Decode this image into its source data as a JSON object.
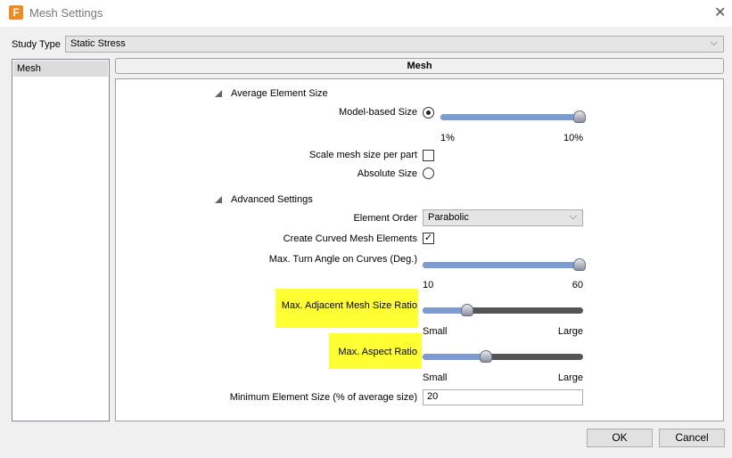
{
  "window": {
    "title": "Mesh Settings",
    "logo": "F"
  },
  "study_type": {
    "label": "Study Type",
    "value": "Static Stress"
  },
  "sidebar": {
    "items": [
      {
        "label": "Mesh"
      }
    ]
  },
  "panel": {
    "title": "Mesh"
  },
  "average_element_size": {
    "heading": "Average Element Size",
    "model_based_label": "Model-based Size",
    "model_based_selected": true,
    "slider_value_percent": 100,
    "min_label": "1%",
    "max_label": "10%",
    "scale_per_part_label": "Scale mesh size per part",
    "scale_per_part_checked": false,
    "absolute_label": "Absolute Size",
    "absolute_selected": false
  },
  "advanced": {
    "heading": "Advanced Settings",
    "element_order_label": "Element Order",
    "element_order_value": "Parabolic",
    "curved_label": "Create Curved Mesh Elements",
    "curved_checked": true,
    "turn_angle_label": "Max. Turn Angle on Curves (Deg.)",
    "turn_angle_percent": 100,
    "turn_min": "10",
    "turn_max": "60",
    "adjacent_label": "Max. Adjacent Mesh Size Ratio",
    "adjacent_percent": 27,
    "adjacent_min": "Small",
    "adjacent_max": "Large",
    "aspect_label": "Max. Aspect Ratio",
    "aspect_percent": 39,
    "aspect_min": "Small",
    "aspect_max": "Large",
    "min_size_label": "Minimum Element Size (% of average size)",
    "min_size_value": "20"
  },
  "buttons": {
    "ok": "OK",
    "cancel": "Cancel"
  },
  "colors": {
    "highlight": "#ffff33",
    "slider_fill": "#7b9bd1"
  }
}
